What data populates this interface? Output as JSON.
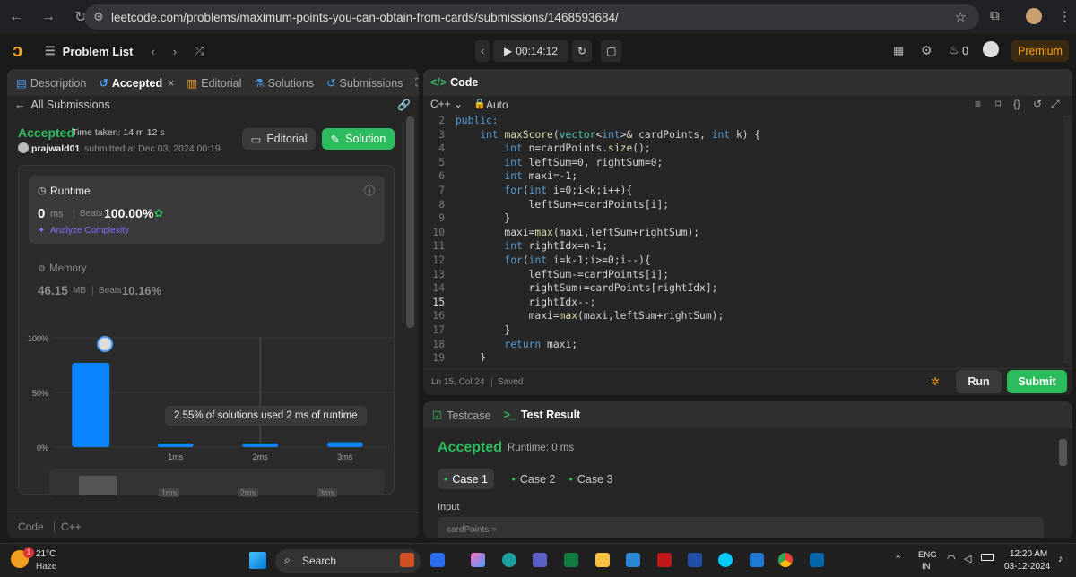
{
  "browser": {
    "url": "leetcode.com/problems/maximum-points-you-can-obtain-from-cards/submissions/1468593684/"
  },
  "topbar": {
    "problem_list": "Problem List",
    "timer": "00:14:12",
    "coins": "0",
    "premium": "Premium"
  },
  "left_tabs": [
    {
      "label": "Description"
    },
    {
      "label": "Accepted"
    },
    {
      "label": "Editorial"
    },
    {
      "label": "Solutions"
    },
    {
      "label": "Submissions"
    }
  ],
  "submission": {
    "back_label": "All Submissions",
    "status": "Accepted",
    "time_taken": "Time taken: 14 m 12 s",
    "user": "prajwald01",
    "submitted_at": "submitted at Dec 03, 2024 00:19",
    "editorial_btn": "Editorial",
    "solution_btn": "Solution"
  },
  "runtime": {
    "label": "Runtime",
    "value": "0",
    "unit": "ms",
    "beats_label": "Beats",
    "beats": "100.00%",
    "analyze": "Analyze Complexity"
  },
  "memory": {
    "label": "Memory",
    "value": "46.15",
    "unit": "MB",
    "beats_label": "Beats",
    "beats": "10.16%"
  },
  "chart_data": {
    "type": "bar",
    "categories": [
      "0ms",
      "1ms",
      "2ms",
      "3ms"
    ],
    "values": [
      77,
      1.5,
      2.55,
      4.5
    ],
    "y_ticks": [
      "100%",
      "50%",
      "0%"
    ],
    "x_tick_labels": [
      "1ms",
      "2ms",
      "3ms"
    ],
    "ylim": [
      0,
      100
    ],
    "tooltip": "2.55% of solutions used 2 ms of runtime",
    "bar_color": "#0a84ff",
    "mini_labels": [
      "1ms",
      "2ms",
      "3ms"
    ]
  },
  "left_footer": {
    "code": "Code",
    "lang": "C++"
  },
  "editor": {
    "title": "Code",
    "lang": "C++",
    "mode": "Auto",
    "status_pos": "Ln 15, Col 24",
    "status_saved": "Saved",
    "run": "Run",
    "submit": "Submit",
    "lines": [
      {
        "n": "2",
        "t": "public:"
      },
      {
        "n": "3",
        "t": "    int maxScore(vector<int>& cardPoints, int k) {"
      },
      {
        "n": "4",
        "t": "        int n=cardPoints.size();"
      },
      {
        "n": "5",
        "t": "        int leftSum=0, rightSum=0;"
      },
      {
        "n": "6",
        "t": "        int maxi=-1;"
      },
      {
        "n": "7",
        "t": "        for(int i=0;i<k;i++){"
      },
      {
        "n": "8",
        "t": "            leftSum+=cardPoints[i];"
      },
      {
        "n": "9",
        "t": "        }"
      },
      {
        "n": "10",
        "t": "        maxi=max(maxi,leftSum+rightSum);"
      },
      {
        "n": "11",
        "t": "        int rightIdx=n-1;"
      },
      {
        "n": "12",
        "t": "        for(int i=k-1;i>=0;i--){"
      },
      {
        "n": "13",
        "t": "            leftSum-=cardPoints[i];"
      },
      {
        "n": "14",
        "t": "            rightSum+=cardPoints[rightIdx];"
      },
      {
        "n": "15",
        "t": "            rightIdx--;"
      },
      {
        "n": "16",
        "t": "            maxi=max(maxi,leftSum+rightSum);"
      },
      {
        "n": "17",
        "t": "        }"
      },
      {
        "n": "18",
        "t": "        return maxi;"
      },
      {
        "n": "19",
        "t": "    }"
      }
    ]
  },
  "testpanel": {
    "tab_testcase": "Testcase",
    "tab_result": "Test Result",
    "status": "Accepted",
    "runtime": "Runtime: 0 ms",
    "cases": [
      "Case 1",
      "Case 2",
      "Case 3"
    ],
    "input_label": "Input",
    "input_var": "cardPoints ="
  },
  "taskbar": {
    "weather_temp": "21°C",
    "weather_desc": "Haze",
    "search": "Search",
    "lang1": "ENG",
    "lang2": "IN",
    "time": "12:20 AM",
    "date": "03-12-2024",
    "badge": "1"
  }
}
